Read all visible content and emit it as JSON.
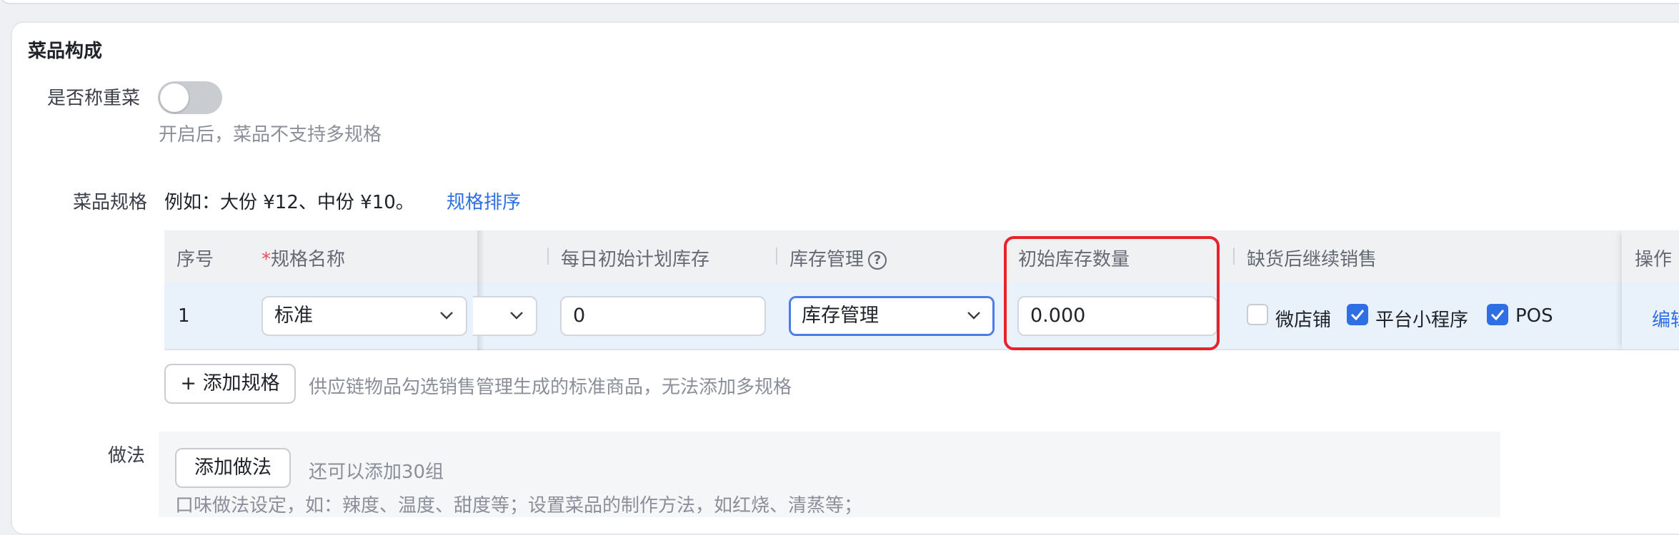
{
  "section": {
    "title": "菜品构成"
  },
  "weigh": {
    "label": "是否称重菜",
    "enabled": false,
    "hint": "开启后，菜品不支持多规格"
  },
  "spec": {
    "label": "菜品规格",
    "example": "例如：大份 ¥12、中份 ¥10。",
    "sort_link": "规格排序",
    "columns": {
      "index": "序号",
      "required_mark": "*",
      "name": "规格名称",
      "daily_stock": "每日初始计划库存",
      "stock_mgmt": "库存管理",
      "stock_mgmt_help": "?",
      "init_stock": "初始库存数量",
      "continue_sale": "缺货后继续销售",
      "ops": "操作"
    },
    "rows": [
      {
        "index": "1",
        "name": "标准",
        "daily_stock": "0",
        "stock_mgmt": "库存管理",
        "init_stock": "0.000",
        "channels": [
          {
            "label": "微店铺",
            "checked": false
          },
          {
            "label": "平台小程序",
            "checked": true
          },
          {
            "label": "POS",
            "checked": true
          }
        ],
        "op": "编辑"
      }
    ],
    "add_button": "+ 添加规格",
    "add_hint": "供应链物品勾选销售管理生成的标准商品，无法添加多规格"
  },
  "method": {
    "label": "做法",
    "add_button": "添加做法",
    "remaining": "还可以添加30组",
    "desc": "口味做法设定，如：辣度、温度、甜度等；设置菜品的制作方法，如红烧、清蒸等；"
  },
  "colors": {
    "accent": "#2f6fe4",
    "highlight": "#e8212b",
    "row_bg": "#e9f1fb"
  },
  "icons": {
    "chevron": "chevron-down-icon",
    "help": "question-circle-icon",
    "check": "check-icon"
  }
}
